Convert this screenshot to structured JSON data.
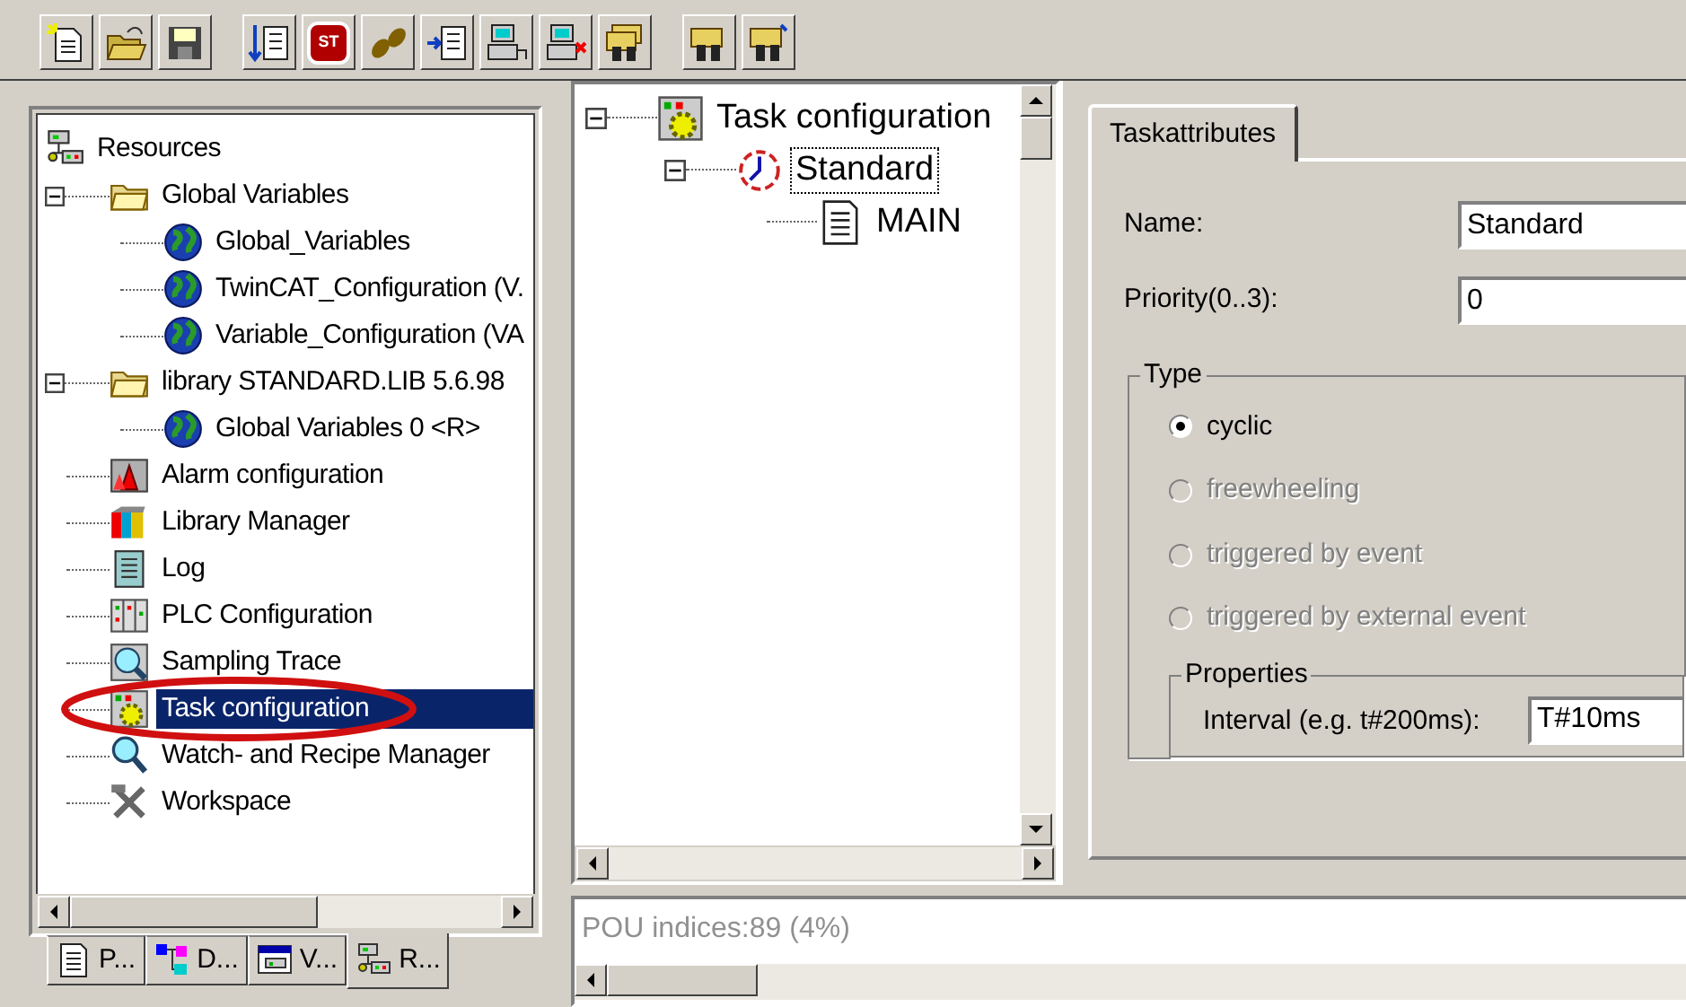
{
  "toolbar": {
    "groups": [
      [
        {
          "kind": "new"
        },
        {
          "kind": "open"
        },
        {
          "kind": "save"
        }
      ],
      [
        {
          "kind": "download"
        },
        {
          "kind": "stop",
          "label": "ST"
        },
        {
          "kind": "step"
        },
        {
          "kind": "step-in"
        },
        {
          "kind": "connect"
        },
        {
          "kind": "disconnect"
        },
        {
          "kind": "find-stack"
        }
      ],
      [
        {
          "kind": "find"
        },
        {
          "kind": "find-next"
        }
      ]
    ]
  },
  "resource_tree": {
    "items": [
      {
        "label": "Resources",
        "kind": "resources",
        "selected": false,
        "children": [
          {
            "label": "Global Variables",
            "kind": "folder",
            "selected": false,
            "expanded": true,
            "children": [
              {
                "label": "Global_Variables",
                "kind": "globe",
                "selected": false
              },
              {
                "label": "TwinCAT_Configuration (V.",
                "kind": "globe",
                "selected": false
              },
              {
                "label": "Variable_Configuration (VA",
                "kind": "globe",
                "selected": false
              }
            ]
          },
          {
            "label": "library STANDARD.LIB 5.6.98",
            "kind": "folder",
            "selected": false,
            "expanded": true,
            "children": [
              {
                "label": "Global Variables 0 <R>",
                "kind": "globe",
                "selected": false
              }
            ]
          },
          {
            "label": "Alarm configuration",
            "kind": "alarm",
            "selected": false
          },
          {
            "label": "Library Manager",
            "kind": "books",
            "selected": false
          },
          {
            "label": "Log",
            "kind": "log",
            "selected": false
          },
          {
            "label": "PLC Configuration",
            "kind": "plc",
            "selected": false
          },
          {
            "label": "Sampling Trace",
            "kind": "trace",
            "selected": false
          },
          {
            "label": "Task configuration",
            "kind": "task",
            "selected": true,
            "circled": true
          },
          {
            "label": "Watch- and Recipe Manager",
            "kind": "watch",
            "selected": false
          },
          {
            "label": "Workspace",
            "kind": "tools",
            "selected": false
          }
        ]
      }
    ]
  },
  "bottom_tabs": [
    {
      "label": "P...",
      "kind": "pou",
      "selected": false
    },
    {
      "label": "D...",
      "kind": "types",
      "selected": false
    },
    {
      "label": "V...",
      "kind": "visual",
      "selected": false
    },
    {
      "label": "R...",
      "kind": "resources",
      "selected": true
    }
  ],
  "task_tree": {
    "items": [
      {
        "label": "Task configuration",
        "kind": "task",
        "selected": false,
        "expanded": true,
        "children": [
          {
            "label": "Standard",
            "kind": "clock",
            "selected": true,
            "expanded": true,
            "children": [
              {
                "label": "MAIN",
                "kind": "program",
                "selected": false
              }
            ]
          }
        ]
      }
    ]
  },
  "task_attributes": {
    "tabs": [
      {
        "label": "Taskattributes",
        "selected": true
      }
    ],
    "name": {
      "label": "Name:",
      "value": "Standard"
    },
    "priority": {
      "label": "Priority(0..3):",
      "value": "0"
    },
    "type_group": {
      "title": "Type",
      "options": [
        {
          "label": "cyclic",
          "selected": true,
          "disabled": false
        },
        {
          "label": "freewheeling",
          "selected": false,
          "disabled": true
        },
        {
          "label": "triggered by event",
          "selected": false,
          "disabled": true
        },
        {
          "label": "triggered by external event",
          "selected": false,
          "disabled": true
        }
      ]
    },
    "properties_group": {
      "title": "Properties",
      "interval_label": "Interval (e.g. t#200ms):",
      "interval_value": "T#10ms"
    }
  },
  "message_window": {
    "text": "POU indices:89 (4%)"
  }
}
